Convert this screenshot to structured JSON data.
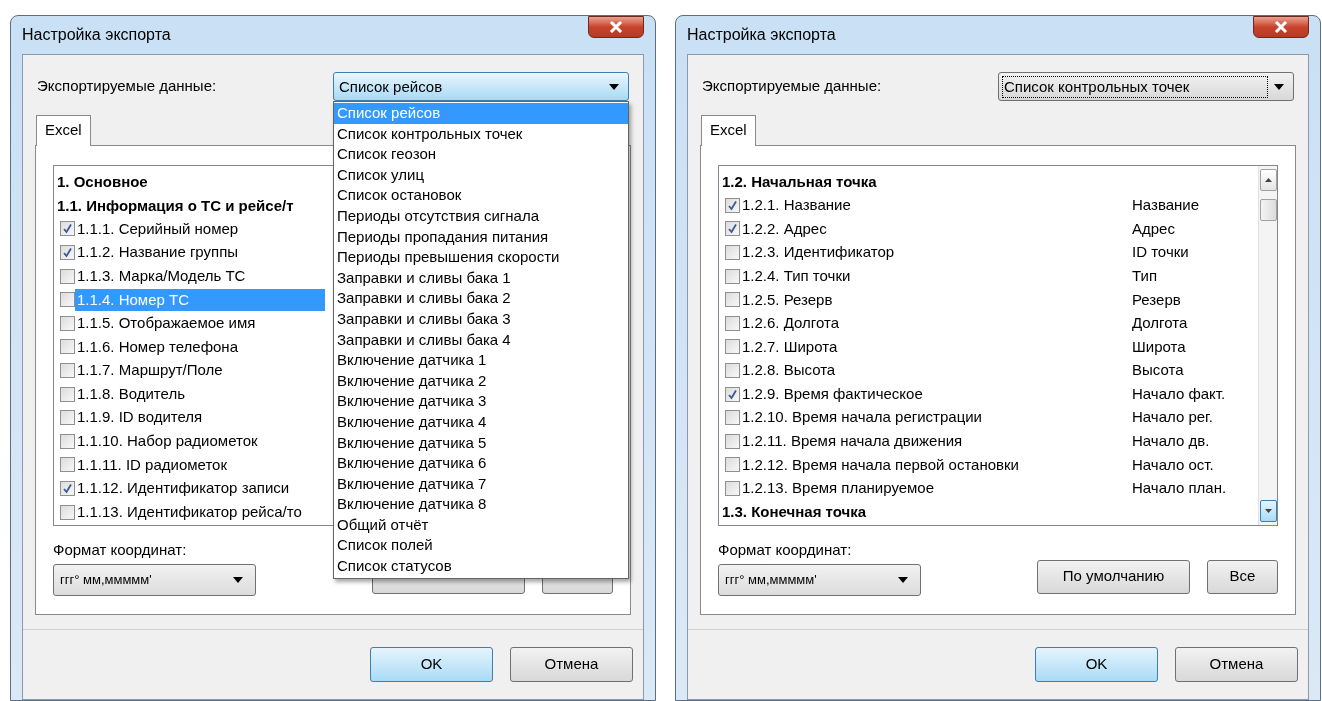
{
  "dialogs": [
    {
      "title": "Настройка экспорта",
      "export_label": "Экспортируемые данные:",
      "export_select": {
        "value": "Список рейсов",
        "open": true,
        "focused": false
      },
      "dropdown": [
        {
          "label": "Список рейсов",
          "selected": true
        },
        {
          "label": "Список контрольных точек",
          "selected": false
        },
        {
          "label": "Список геозон",
          "selected": false
        },
        {
          "label": "Список улиц",
          "selected": false
        },
        {
          "label": "Список остановок",
          "selected": false
        },
        {
          "label": "Периоды отсутствия сигнала",
          "selected": false
        },
        {
          "label": "Периоды пропадания питания",
          "selected": false
        },
        {
          "label": "Периоды превышения скорости",
          "selected": false
        },
        {
          "label": "Заправки и сливы бака 1",
          "selected": false
        },
        {
          "label": "Заправки и сливы бака 2",
          "selected": false
        },
        {
          "label": "Заправки и сливы бака 3",
          "selected": false
        },
        {
          "label": "Заправки и сливы бака 4",
          "selected": false
        },
        {
          "label": "Включение датчика 1",
          "selected": false
        },
        {
          "label": "Включение датчика 2",
          "selected": false
        },
        {
          "label": "Включение датчика 3",
          "selected": false
        },
        {
          "label": "Включение датчика 4",
          "selected": false
        },
        {
          "label": "Включение датчика 5",
          "selected": false
        },
        {
          "label": "Включение датчика 6",
          "selected": false
        },
        {
          "label": "Включение датчика 7",
          "selected": false
        },
        {
          "label": "Включение датчика 8",
          "selected": false
        },
        {
          "label": "Общий отчёт",
          "selected": false
        },
        {
          "label": "Список полей",
          "selected": false
        },
        {
          "label": "Список статусов",
          "selected": false
        }
      ],
      "tabs": [
        {
          "label": "Excel",
          "selected": true
        }
      ],
      "list": {
        "scrollbar": false,
        "rows": [
          {
            "kind": "header",
            "label": "1. Основное"
          },
          {
            "kind": "header",
            "label": "1.1. Информация о ТС и рейсе/т"
          },
          {
            "kind": "item",
            "label": "1.1.1. Серийный номер",
            "checked": true,
            "selected": false
          },
          {
            "kind": "item",
            "label": "1.1.2. Название группы",
            "checked": true,
            "selected": false
          },
          {
            "kind": "item",
            "label": "1.1.3. Марка/Модель ТС",
            "checked": false,
            "selected": false
          },
          {
            "kind": "item",
            "label": "1.1.4. Номер ТС",
            "checked": false,
            "selected": true
          },
          {
            "kind": "item",
            "label": "1.1.5. Отображаемое имя",
            "checked": false,
            "selected": false
          },
          {
            "kind": "item",
            "label": "1.1.6. Номер телефона",
            "checked": false,
            "selected": false
          },
          {
            "kind": "item",
            "label": "1.1.7. Маршрут/Поле",
            "checked": false,
            "selected": false
          },
          {
            "kind": "item",
            "label": "1.1.8. Водитель",
            "checked": false,
            "selected": false
          },
          {
            "kind": "item",
            "label": "1.1.9. ID водителя",
            "checked": false,
            "selected": false
          },
          {
            "kind": "item",
            "label": "1.1.10. Набор радиометок",
            "checked": false,
            "selected": false
          },
          {
            "kind": "item",
            "label": "1.1.11. ID радиометок",
            "checked": false,
            "selected": false
          },
          {
            "kind": "item",
            "label": "1.1.12. Идентификатор записи",
            "checked": true,
            "selected": false
          },
          {
            "kind": "item",
            "label": "1.1.13. Идентификатор рейса/то",
            "checked": false,
            "selected": false
          }
        ]
      },
      "coord_label": "Формат координат:",
      "coord_select": {
        "value": "ггг° мм,ммммм'"
      },
      "side_buttons": [
        {
          "kind": "default"
        },
        {
          "kind": "all"
        }
      ],
      "buttons": [
        {
          "label": "OK",
          "default": true
        },
        {
          "label": "Отмена",
          "default": false
        }
      ]
    },
    {
      "title": "Настройка экспорта",
      "export_label": "Экспортируемые данные:",
      "export_select": {
        "value": "Список контрольных точек",
        "open": false,
        "focused": true
      },
      "tabs": [
        {
          "label": "Excel",
          "selected": true
        }
      ],
      "list": {
        "scrollbar": true,
        "rows": [
          {
            "kind": "header",
            "label": "1.2. Начальная точка"
          },
          {
            "kind": "item",
            "label": "1.2.1. Название",
            "alias": "Название",
            "checked": true,
            "selected": false
          },
          {
            "kind": "item",
            "label": "1.2.2. Адрес",
            "alias": "Адрес",
            "checked": true,
            "selected": false
          },
          {
            "kind": "item",
            "label": "1.2.3. Идентификатор",
            "alias": "ID точки",
            "checked": false,
            "selected": false
          },
          {
            "kind": "item",
            "label": "1.2.4. Тип точки",
            "alias": "Тип",
            "checked": false,
            "selected": false
          },
          {
            "kind": "item",
            "label": "1.2.5. Резерв",
            "alias": "Резерв",
            "checked": false,
            "selected": false
          },
          {
            "kind": "item",
            "label": "1.2.6. Долгота",
            "alias": "Долгота",
            "checked": false,
            "selected": false
          },
          {
            "kind": "item",
            "label": "1.2.7. Широта",
            "alias": "Широта",
            "checked": false,
            "selected": false
          },
          {
            "kind": "item",
            "label": "1.2.8. Высота",
            "alias": "Высота",
            "checked": false,
            "selected": false
          },
          {
            "kind": "item",
            "label": "1.2.9. Время фактическое",
            "alias": "Начало факт.",
            "checked": true,
            "selected": false
          },
          {
            "kind": "item",
            "label": "1.2.10. Время начала регистрации",
            "alias": "Начало рег.",
            "checked": false,
            "selected": false
          },
          {
            "kind": "item",
            "label": "1.2.11. Время начала движения",
            "alias": "Начало дв.",
            "checked": false,
            "selected": false
          },
          {
            "kind": "item",
            "label": "1.2.12. Время начала первой остановки",
            "alias": "Начало ост.",
            "checked": false,
            "selected": false
          },
          {
            "kind": "item",
            "label": "1.2.13. Время планируемое",
            "alias": "Начало план.",
            "checked": false,
            "selected": false
          },
          {
            "kind": "header",
            "label": "1.3. Конечная точка"
          }
        ]
      },
      "coord_label": "Формат координат:",
      "coord_select": {
        "value": "ггг° мм,ммммм'"
      },
      "side_buttons": [
        {
          "kind": "default",
          "label": "По умолчанию"
        },
        {
          "kind": "all",
          "label": "Все"
        }
      ],
      "buttons": [
        {
          "label": "OK",
          "default": true
        },
        {
          "label": "Отмена",
          "default": false
        }
      ]
    }
  ]
}
